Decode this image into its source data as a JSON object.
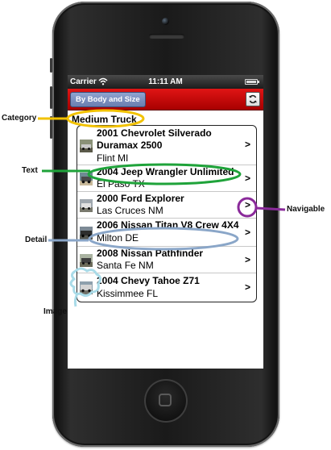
{
  "status_bar": {
    "carrier": "Carrier",
    "time": "11:11 AM",
    "icons": [
      "wifi-icon",
      "battery-icon"
    ]
  },
  "nav": {
    "filter_button": "By Body and Size",
    "refresh_icon": "refresh-icon"
  },
  "category_heading": "Medium Truck",
  "listings": [
    {
      "title": "2001 Chevrolet Silverado Duramax 2500",
      "location": "Flint MI"
    },
    {
      "title": "2004 Jeep Wrangler Unlimited",
      "location": "El Paso TX"
    },
    {
      "title": "2000 Ford Explorer",
      "location": "Las Cruces NM"
    },
    {
      "title": "2006 Nissan Titan V8 Crew 4X4",
      "location": "Milton DE"
    },
    {
      "title": "2008 Nissan Pathfinder",
      "location": "Santa Fe NM"
    },
    {
      "title": "2004 Chevy Tahoe Z71",
      "location": "Kissimmee FL"
    }
  ],
  "chevron_symbol": ">",
  "annotations": {
    "category": "Category",
    "text": "Text",
    "detail": "Detail",
    "image": "Image",
    "navigable": "Navigable"
  },
  "annotation_colors": {
    "category": "#f2c200",
    "text": "#1fa33a",
    "detail": "#8aa6c8",
    "image": "#a9dbe8",
    "navigable": "#8a2a9a"
  },
  "colors": {
    "navbar": "#c80000",
    "filter_button": "#7b8fc0"
  }
}
